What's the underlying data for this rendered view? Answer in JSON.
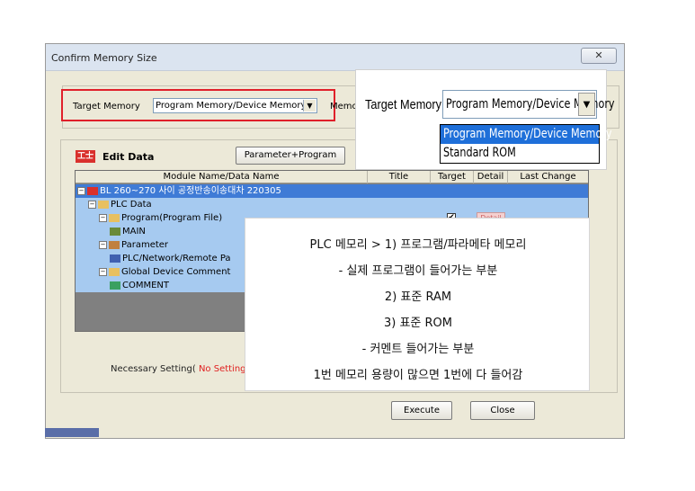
{
  "dialog": {
    "title": "Confirm Memory Size",
    "close_glyph": "✕",
    "target_memory_label": "Target Memory",
    "target_memory_value": "Program Memory/Device Memory",
    "memory_cut_label": "Memor",
    "edit_data_icon_text": "工士",
    "edit_data_label": "Edit Data",
    "param_button": "Parameter+Program",
    "necessary_setting_label": "Necessary Setting(",
    "necessary_setting_value": "No Setting /",
    "execute_button": "Execute",
    "close_button": "Close"
  },
  "grid": {
    "columns": [
      "Module Name/Data Name",
      "Title",
      "Target",
      "Detail",
      "Last Change"
    ],
    "rows": [
      {
        "label": "BL 260~270 사이 공정반송이송대차 220305",
        "level": 0,
        "expander": "−",
        "icon": "plc-icon",
        "selected": true
      },
      {
        "label": "PLC Data",
        "level": 1,
        "expander": "−",
        "icon": "folder-icon",
        "selected": false
      },
      {
        "label": "Program(Program File)",
        "level": 2,
        "expander": "−",
        "icon": "program-folder-icon",
        "selected": false,
        "target_checked": true,
        "detail": "Detail"
      },
      {
        "label": "MAIN",
        "level": 3,
        "expander": "",
        "icon": "program-icon",
        "selected": false
      },
      {
        "label": "Parameter",
        "level": 2,
        "expander": "−",
        "icon": "parameter-folder-icon",
        "selected": false
      },
      {
        "label": "PLC/Network/Remote Pa",
        "level": 3,
        "expander": "",
        "icon": "parameter-icon",
        "selected": false
      },
      {
        "label": "Global Device Comment",
        "level": 2,
        "expander": "−",
        "icon": "folder-icon",
        "selected": false
      },
      {
        "label": "COMMENT",
        "level": 3,
        "expander": "",
        "icon": "comment-icon",
        "selected": false
      }
    ]
  },
  "zoom": {
    "label": "Target Memory",
    "value": "Program Memory/Device Memory",
    "arrow": "▼",
    "options": [
      {
        "label": "Program Memory/Device Memory",
        "selected": true
      },
      {
        "label": "Standard ROM",
        "selected": false
      }
    ]
  },
  "note": {
    "lines": [
      "PLC 메모리 > 1) 프로그램/파라메타 메모리",
      "- 실제 프로그램이 들어가는 부분",
      "2) 표준 RAM",
      "3) 표준 ROM",
      "- 커멘트 들어가는 부분",
      "1번 메모리 용량이 많으면 1번에 다 들어감"
    ]
  },
  "colors": {
    "highlight_red": "#e0202a",
    "row_blue": "#a6caf0",
    "row_selected": "#3f7bd6",
    "list_selected": "#1e6fd9"
  }
}
